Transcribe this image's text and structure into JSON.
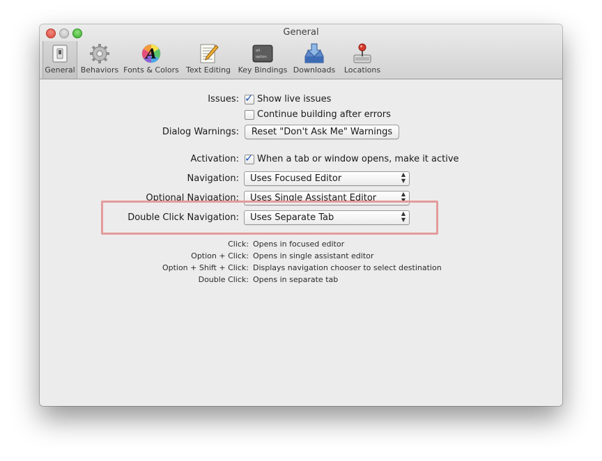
{
  "window": {
    "title": "General"
  },
  "toolbar": {
    "items": [
      {
        "label": "General",
        "icon": "switch-icon",
        "selected": true
      },
      {
        "label": "Behaviors",
        "icon": "gear-icon"
      },
      {
        "label": "Fonts & Colors",
        "icon": "font-color-icon"
      },
      {
        "label": "Text Editing",
        "icon": "text-editing-icon"
      },
      {
        "label": "Key Bindings",
        "icon": "keys-icon"
      },
      {
        "label": "Downloads",
        "icon": "download-icon"
      },
      {
        "label": "Locations",
        "icon": "joystick-icon"
      }
    ],
    "key_caps": [
      "alt",
      "option"
    ]
  },
  "settings": {
    "issues_label": "Issues:",
    "show_live_issues": "Show live issues",
    "continue_building": "Continue building after errors",
    "dialog_warnings_label": "Dialog Warnings:",
    "reset_button": "Reset \"Don't Ask Me\" Warnings",
    "activation_label": "Activation:",
    "activation_text": "When a tab or window opens, make it active",
    "navigation_label": "Navigation:",
    "navigation_value": "Uses Focused Editor",
    "optional_navigation_label": "Optional Navigation:",
    "optional_navigation_value": "Uses Single Assistant Editor",
    "double_click_label": "Double Click Navigation:",
    "double_click_value": "Uses Separate Tab",
    "show_live_issues_checked": true,
    "continue_building_checked": false,
    "activation_checked": true
  },
  "help": [
    {
      "key": "Click:",
      "value": "Opens in focused editor"
    },
    {
      "key": "Option + Click:",
      "value": "Opens in single assistant editor"
    },
    {
      "key": "Option + Shift + Click:",
      "value": "Displays navigation chooser to select destination"
    },
    {
      "key": "Double Click:",
      "value": "Opens in separate tab"
    }
  ],
  "colors": {
    "highlight": "#e39b9b",
    "check": "#1b55b5"
  }
}
